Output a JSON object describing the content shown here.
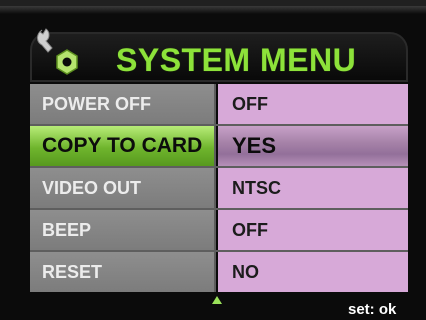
{
  "header": {
    "title": "SYSTEM MENU",
    "icon": "wrench-nut-icon"
  },
  "menu": {
    "rows": [
      {
        "label": "POWER OFF",
        "value": "OFF",
        "selected": false
      },
      {
        "label": "COPY TO CARD",
        "value": "YES",
        "selected": true
      },
      {
        "label": "VIDEO OUT",
        "value": "NTSC",
        "selected": false
      },
      {
        "label": "BEEP",
        "value": "OFF",
        "selected": false
      },
      {
        "label": "RESET",
        "value": "NO",
        "selected": false
      }
    ]
  },
  "footer": {
    "scroll_indicator": "up-arrow-icon",
    "hint": "set: ok"
  },
  "colors": {
    "title": "#8de23a",
    "label_bg": "#8e8e8e",
    "value_bg": "#d7a9d8",
    "selected_label_bg": "#6fb52d",
    "selected_value_bg": "#a783a9"
  }
}
